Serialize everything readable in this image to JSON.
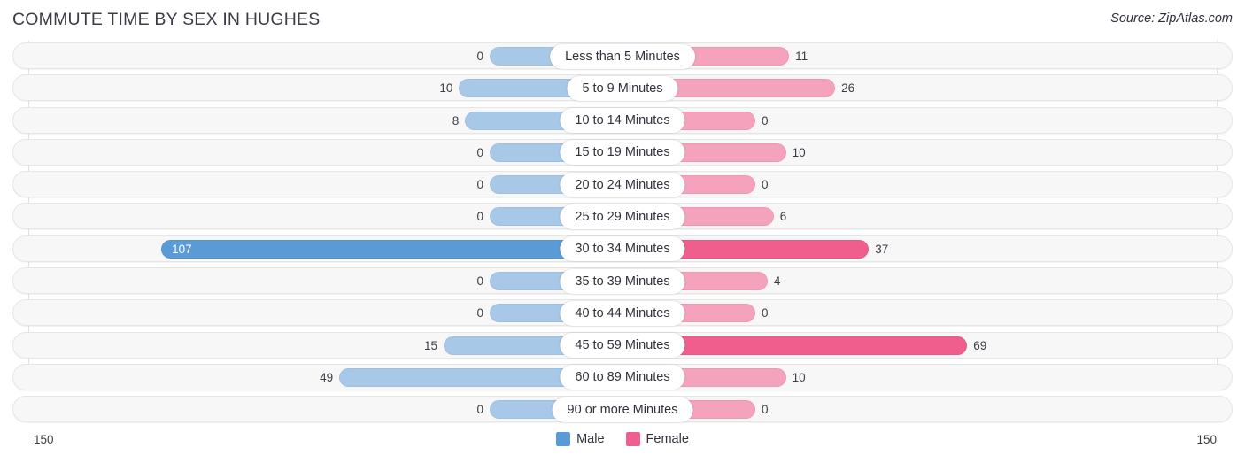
{
  "header": {
    "title": "COMMUTE TIME BY SEX IN HUGHES",
    "source": "Source: ZipAtlas.com"
  },
  "axis": {
    "left_end": "150",
    "right_end": "150"
  },
  "legend": {
    "items": [
      {
        "label": "Male",
        "color": "#5b9bd5"
      },
      {
        "label": "Female",
        "color": "#ef5e8c"
      }
    ]
  },
  "colors": {
    "male_strong": "#5b9bd5",
    "male_light": "#a8c8e8",
    "female_strong": "#ef5e8c",
    "female_light": "#f5a3bd",
    "track_bg": "#f7f7f7",
    "track_border": "#e6e6e6",
    "gridline": "#e2e2e2"
  },
  "chart_data": {
    "type": "bar",
    "title": "COMMUTE TIME BY SEX IN HUGHES",
    "subtitle": "Source: ZipAtlas.com",
    "orientation": "horizontal",
    "style": "diverging-bidirectional",
    "xlabel": "",
    "ylabel": "",
    "xlim": [
      -150,
      150
    ],
    "axis_max": 150,
    "grid": false,
    "legend_position": "bottom-center",
    "categories": [
      "Less than 5 Minutes",
      "5 to 9 Minutes",
      "10 to 14 Minutes",
      "15 to 19 Minutes",
      "20 to 24 Minutes",
      "25 to 29 Minutes",
      "30 to 34 Minutes",
      "35 to 39 Minutes",
      "40 to 44 Minutes",
      "45 to 59 Minutes",
      "60 to 89 Minutes",
      "90 or more Minutes"
    ],
    "series": [
      {
        "name": "Male",
        "color": "#5b9bd5",
        "direction": "left",
        "values": [
          0,
          10,
          8,
          0,
          0,
          0,
          107,
          0,
          0,
          15,
          49,
          0
        ]
      },
      {
        "name": "Female",
        "color": "#ef5e8c",
        "direction": "right",
        "values": [
          11,
          26,
          0,
          10,
          0,
          6,
          37,
          4,
          0,
          69,
          10,
          0
        ]
      }
    ]
  }
}
